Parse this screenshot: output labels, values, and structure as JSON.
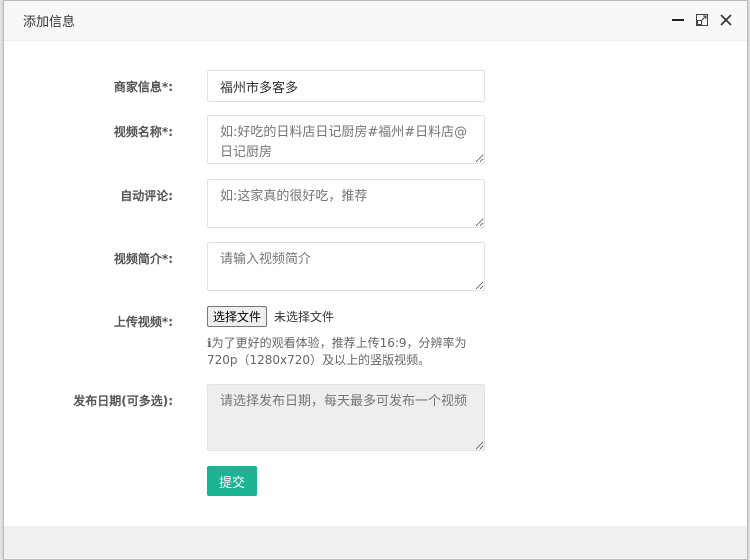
{
  "dialog": {
    "title": "添加信息"
  },
  "form": {
    "merchant": {
      "label": "商家信息*:",
      "value": "福州市多客多"
    },
    "video_name": {
      "label": "视频名称*:",
      "placeholder": "如:好吃的日料店日记厨房#福州#日料店@日记厨房"
    },
    "auto_comment": {
      "label": "自动评论:",
      "placeholder": "如:这家真的很好吃，推荐"
    },
    "intro": {
      "label": "视频简介*:",
      "placeholder": "请输入视频简介"
    },
    "upload": {
      "label": "上传视频*:",
      "button": "选择文件",
      "status": "未选择文件",
      "hint": "为了更好的观看体验，推荐上传16:9，分辨率为720p（1280x720）及以上的竖版视频。"
    },
    "publish_date": {
      "label": "发布日期(可多选):",
      "placeholder": "请选择发布日期，每天最多可发布一个视频"
    },
    "submit": "提交"
  },
  "colors": {
    "accent": "#1cb394"
  }
}
